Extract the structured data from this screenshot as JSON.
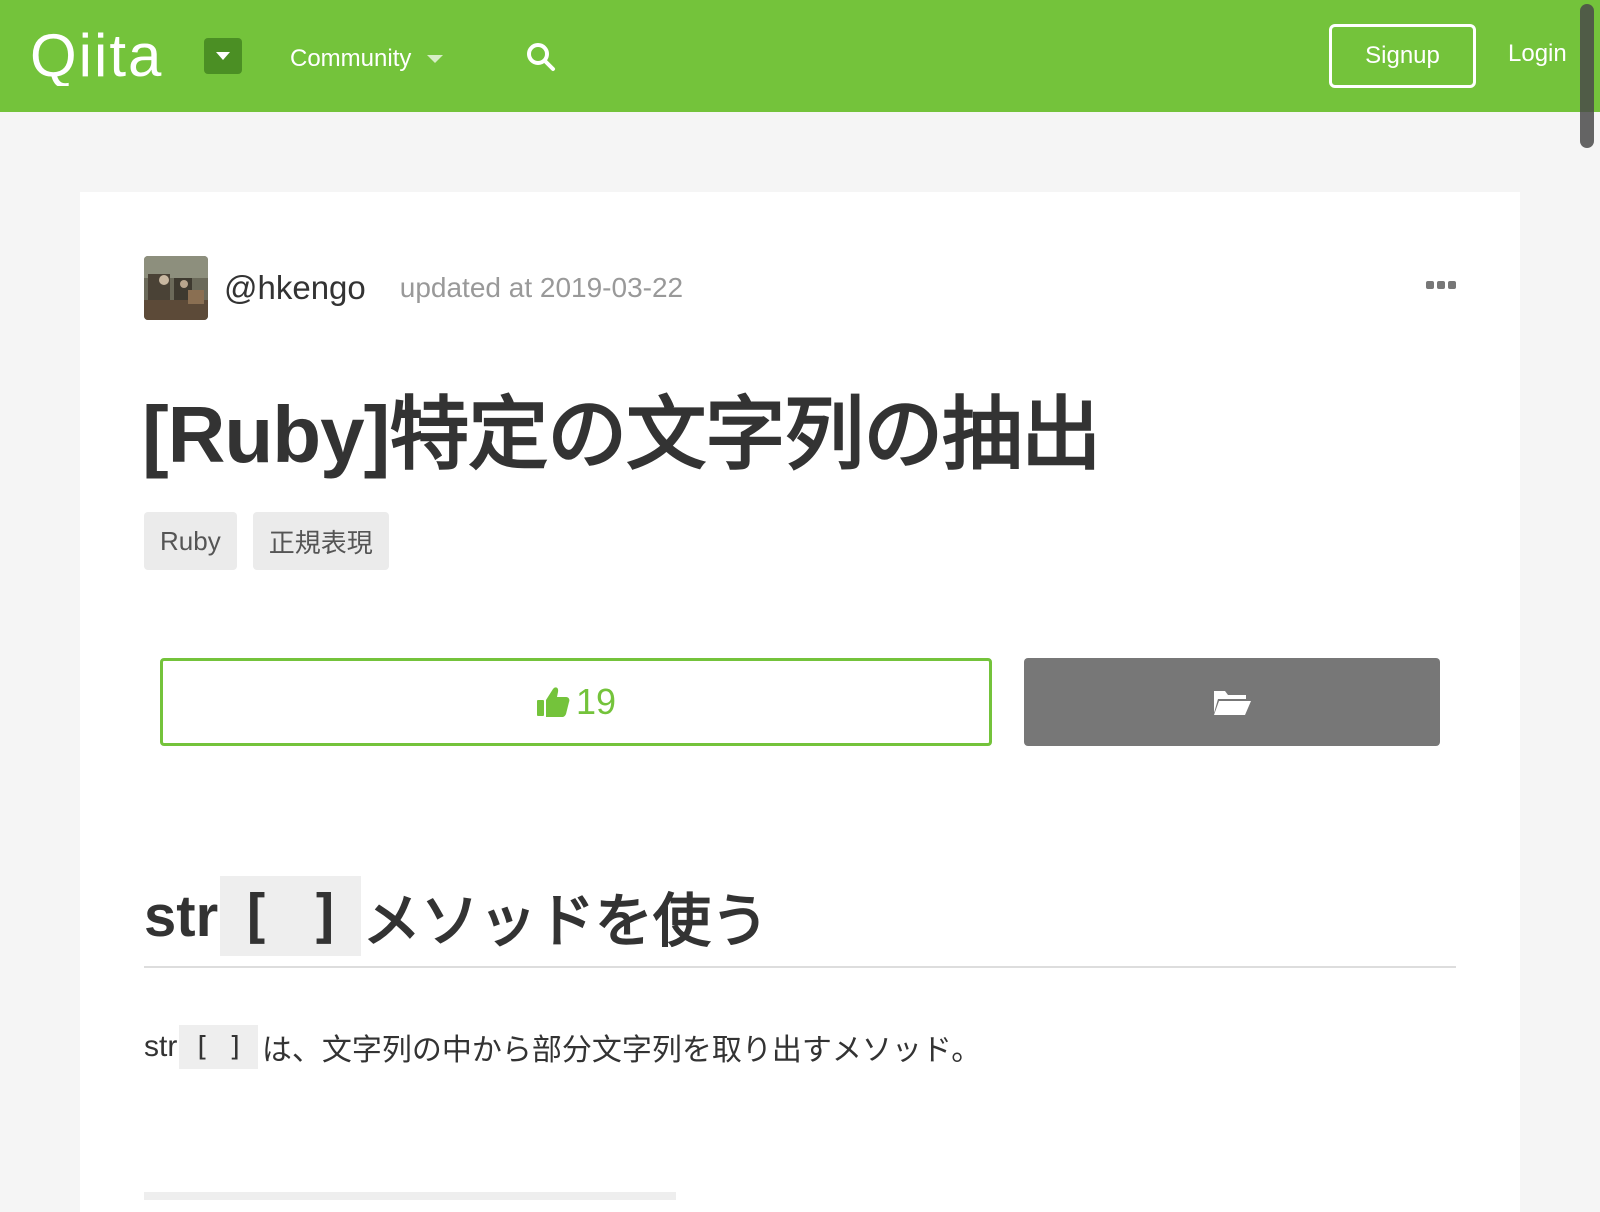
{
  "header": {
    "logo_text": "Qiita",
    "logo_menu_icon": "caret-down-icon",
    "community_label": "Community",
    "search_icon": "search-icon",
    "signup_label": "Signup",
    "login_label": "Login",
    "colors": {
      "brand": "#74c33b",
      "logo_menu_bg": "#4b8f24"
    }
  },
  "article": {
    "author": {
      "username": "@hkengo",
      "updated": "updated at 2019-03-22"
    },
    "title": "[Ruby]特定の文字列の抽出",
    "tags": [
      {
        "label": "Ruby"
      },
      {
        "label": "正規表現"
      }
    ],
    "like": {
      "icon": "thumbs-up-icon",
      "count": "19"
    },
    "stock": {
      "icon": "folder-open-icon"
    },
    "section": {
      "prefix": "str",
      "code": "[ ]",
      "suffix": "メソッドを使う"
    },
    "body": {
      "prefix": "str",
      "code": "[ ]",
      "suffix": "は、文字列の中から部分文字列を取り出すメソッド。"
    }
  }
}
